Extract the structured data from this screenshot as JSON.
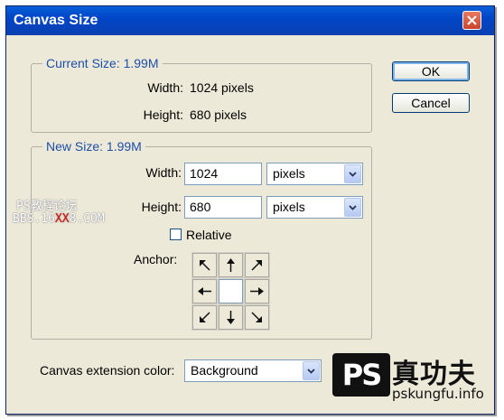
{
  "dialog": {
    "title": "Canvas Size"
  },
  "current_size": {
    "legend": "Current Size: 1.99M",
    "width_label": "Width:",
    "width_value": "1024 pixels",
    "height_label": "Height:",
    "height_value": "680 pixels"
  },
  "new_size": {
    "legend": "New Size: 1.99M",
    "width_label": "Width:",
    "width_value": "1024",
    "width_unit": "pixels",
    "height_label": "Height:",
    "height_value": "680",
    "height_unit": "pixels",
    "relative_label": "Relative",
    "relative_checked": false,
    "anchor_label": "Anchor:"
  },
  "buttons": {
    "ok": "OK",
    "cancel": "Cancel"
  },
  "extension": {
    "label": "Canvas extension color:",
    "value": "Background"
  },
  "watermark_left": {
    "line1": "PS教程论坛",
    "line2_pre": "BBS.16",
    "line2_red": "XX",
    "line2_post": "8.COM"
  },
  "watermark_logo": {
    "brand": "PS",
    "text": "真功夫",
    "url": "pskungfu.info"
  },
  "colors": {
    "title_bar": "#0a4fd1",
    "dialog_bg": "#ece9d8",
    "legend_text": "#1e4fa8",
    "close_button": "#d9573b"
  }
}
